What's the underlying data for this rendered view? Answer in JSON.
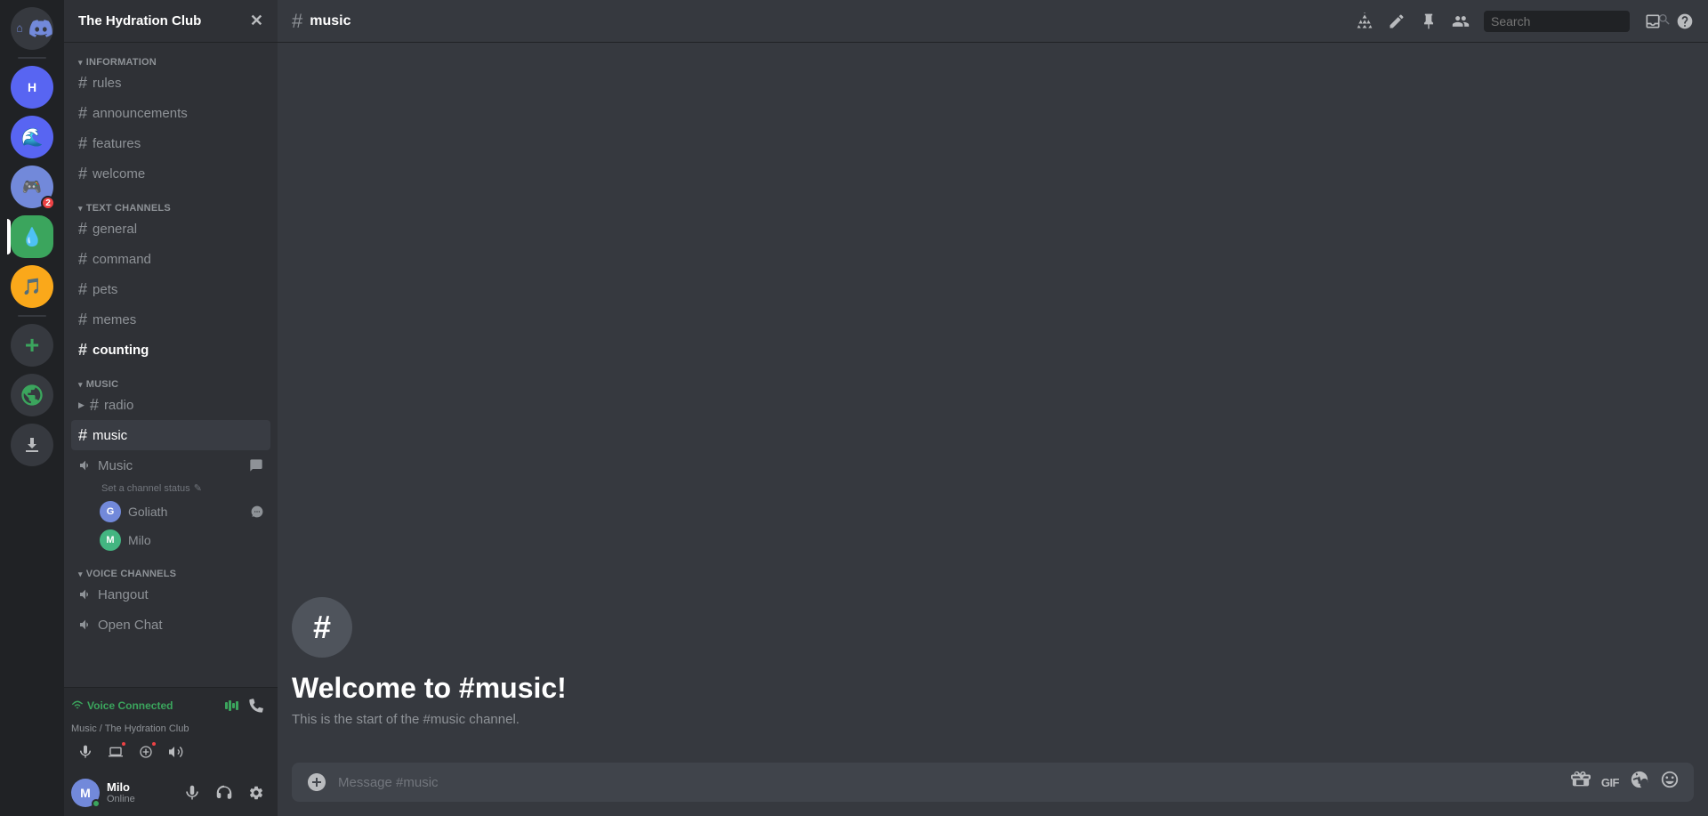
{
  "server": {
    "name": "The Hydration Club",
    "dropdown_icon": "▾"
  },
  "categories": {
    "information": "INFORMATION",
    "text_channels": "TEXT CHANNELS",
    "music": "MUSIC",
    "voice_channels": "VOICE CHANNELS"
  },
  "channels": {
    "information": [
      {
        "name": "rules",
        "type": "text"
      },
      {
        "name": "announcements",
        "type": "text"
      },
      {
        "name": "features",
        "type": "text"
      },
      {
        "name": "welcome",
        "type": "text"
      }
    ],
    "text": [
      {
        "name": "general",
        "type": "text"
      },
      {
        "name": "command",
        "type": "text"
      },
      {
        "name": "pets",
        "type": "text"
      },
      {
        "name": "memes",
        "type": "text"
      },
      {
        "name": "counting",
        "type": "text",
        "bold": true
      }
    ],
    "music": [
      {
        "name": "radio",
        "type": "text",
        "has_arrow": true
      },
      {
        "name": "music",
        "type": "text",
        "active": true
      }
    ],
    "music_voice": {
      "name": "Music",
      "type": "voice",
      "status": "Set a channel status",
      "users": [
        {
          "name": "Goliath",
          "color": "#7289da",
          "icon": "G"
        },
        {
          "name": "Milo",
          "color": "#43b581",
          "icon": "M"
        }
      ]
    },
    "voice": [
      {
        "name": "Hangout",
        "type": "voice"
      },
      {
        "name": "Open Chat",
        "type": "voice"
      }
    ]
  },
  "voice_connected": {
    "label": "Voice Connected",
    "channel_path": "Music / The Hydration Club"
  },
  "user": {
    "name": "Milo",
    "status": "Online",
    "avatar_letter": "M"
  },
  "top_bar": {
    "channel_name": "music",
    "hash": "#"
  },
  "search": {
    "placeholder": "Search"
  },
  "chat": {
    "welcome_title": "Welcome to #music!",
    "welcome_desc": "This is the start of the #music channel.",
    "message_placeholder": "Message #music"
  },
  "icons": {
    "boost": "🚀",
    "pencil": "✏",
    "pin": "📌",
    "members": "👥",
    "inbox": "📥",
    "help": "❓",
    "gift": "🎁",
    "gif": "GIF",
    "sticker": "🪄",
    "emoji": "😊",
    "plus": "＋",
    "mic": "🎤",
    "headphones": "🎧",
    "settings": "⚙"
  }
}
